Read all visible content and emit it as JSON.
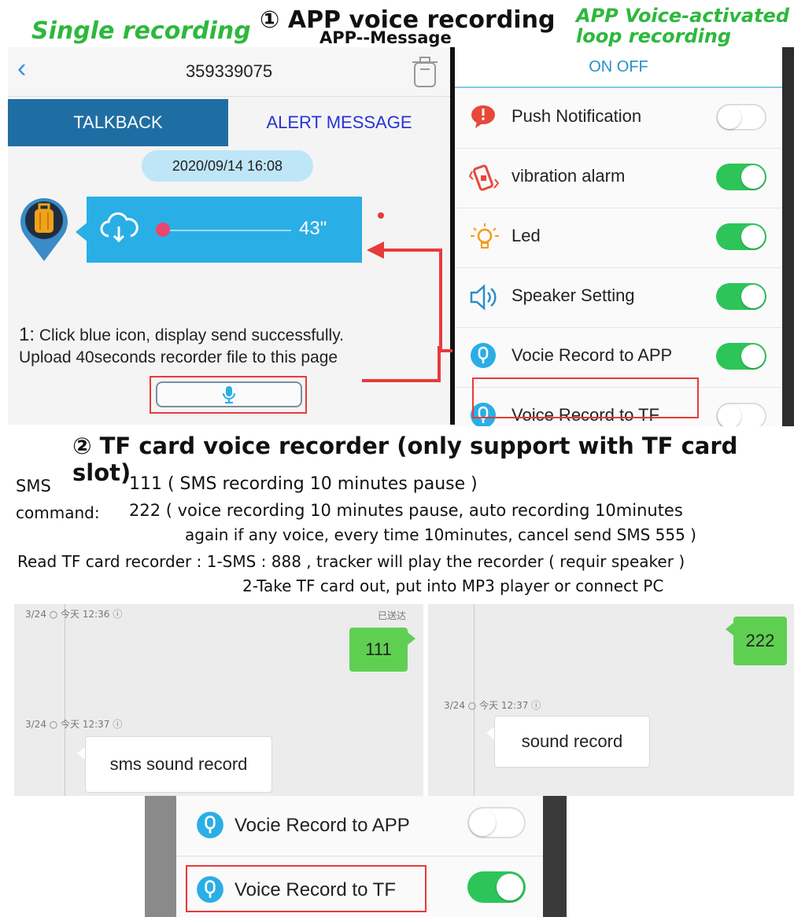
{
  "captions": {
    "single": "Single recording",
    "title": "① APP voice recording",
    "subtitle": "APP--Message",
    "loop_line1": "APP Voice-activated",
    "loop_line2": "loop recording"
  },
  "left_panel": {
    "header_title": "359339075",
    "tab_talkback": "TALKBACK",
    "tab_alert": "ALERT MESSAGE",
    "date": "2020/09/14 16:08",
    "duration": "43\"",
    "instruction_num": "1:",
    "instruction_line1": " Click blue icon, display send successfully.",
    "instruction_line2": "Upload 40seconds  recorder file to this page",
    "icons": {
      "back": "back-chevron-icon",
      "trash": "trash-icon",
      "device": "luggage-icon",
      "cloud": "cloud-download-icon",
      "mic": "microphone-icon"
    }
  },
  "right_panel": {
    "header": "ON OFF",
    "settings": [
      {
        "label": "Push Notification",
        "on": false,
        "icon": "notification-icon"
      },
      {
        "label": "vibration alarm",
        "on": true,
        "icon": "vibration-icon"
      },
      {
        "label": "Led",
        "on": true,
        "icon": "led-icon"
      },
      {
        "label": "Speaker Setting",
        "on": true,
        "icon": "speaker-icon"
      },
      {
        "label": "Vocie Record to APP",
        "on": true,
        "icon": "record-icon"
      },
      {
        "label": "Voice Record to TF",
        "on": false,
        "icon": "record-icon"
      }
    ]
  },
  "section2": {
    "title": "② TF card voice recorder (only support with TF card slot)",
    "sms_label": "SMS",
    "sms_value": "111 ( SMS recording 10 minutes pause )",
    "cmd_label": "command:",
    "cmd_value": "222 ( voice recording 10 minutes pause, auto recording 10minutes",
    "cmd_cont": "again if any voice, every time 10minutes, cancel send SMS 555 )",
    "read_line1": "Read TF card recorder : 1-SMS : 888 , tracker will play the recorder ( requir speaker )",
    "read_line2": "2-Take TF card out, put into MP3 player or connect PC"
  },
  "chat_left": {
    "ts1": "3/24 ○ 今天 12:36 ⓘ",
    "status": "已送达",
    "sent": "111",
    "ts2": "3/24 ○ 今天 12:37 ⓘ",
    "reply": "sms sound record"
  },
  "chat_right": {
    "sent": "222",
    "ts": "3/24 ○ 今天 12:37 ⓘ",
    "reply": "sound record"
  },
  "bottom_panel": {
    "row1_label": "Vocie Record to APP",
    "row1_on": false,
    "row2_label": "Voice Record to TF",
    "row2_on": true
  },
  "colors": {
    "accent_blue": "#2aaee6",
    "tab_blue": "#1f6ea3",
    "toggle_green": "#2dc55a",
    "highlight_red": "#e83a3a",
    "caption_green": "#2db83d"
  }
}
